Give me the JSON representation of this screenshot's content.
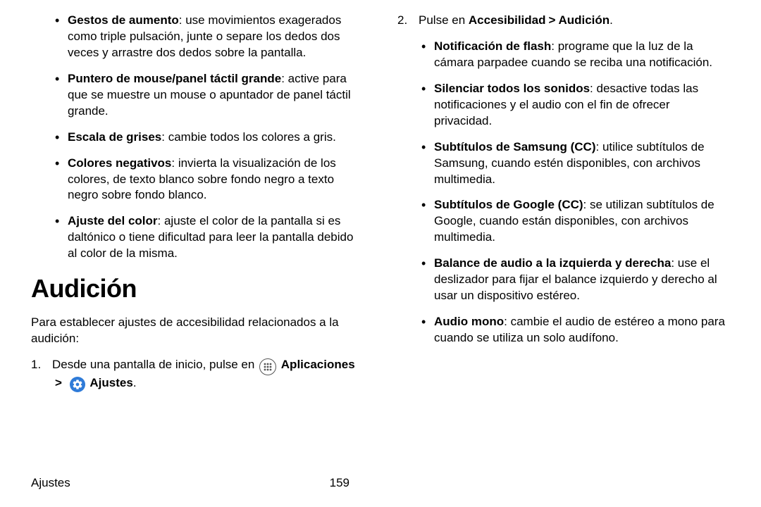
{
  "footer": {
    "section": "Ajustes",
    "page": "159"
  },
  "left": {
    "bullets": [
      {
        "term": "Gestos de aumento",
        "def": ": use movimientos exagerados como triple pulsación, junte o separe los dedos dos veces y arrastre dos dedos sobre la pantalla."
      },
      {
        "term": "Puntero de mouse/panel táctil grande",
        "def": ": active para que se muestre un mouse o apuntador de panel táctil grande."
      },
      {
        "term": "Escala de grises",
        "def": ": cambie todos los colores a gris."
      },
      {
        "term": "Colores negativos",
        "def": ": invierta la visualización de los colores, de texto blanco sobre fondo negro a texto negro sobre fondo blanco."
      },
      {
        "term": "Ajuste del color",
        "def": ": ajuste el color de la pantalla si es daltónico o tiene dificultad para leer la pantalla debido al color de la misma."
      }
    ],
    "heading": "Audición",
    "intro": "Para establecer ajustes de accesibilidad relacionados a la audición:",
    "step1": {
      "num": "1.",
      "pre": "Desde una pantalla de inicio, pulse en ",
      "apps": "Aplicaciones",
      "arrow": ">",
      "settings": "Ajustes",
      "post": "."
    }
  },
  "right": {
    "step2": {
      "num": "2.",
      "pre": "Pulse en ",
      "a": "Accesibilidad",
      "arrow": ">",
      "b": "Audición",
      "post": "."
    },
    "bullets": [
      {
        "term": "Notificación de flash",
        "def": ": programe que la luz de la cámara parpadee cuando se reciba una notificación."
      },
      {
        "term": "Silenciar todos los sonidos",
        "def": ": desactive todas las notificaciones y el audio con el fin de ofrecer privacidad."
      },
      {
        "term": "Subtítulos de Samsung (CC)",
        "def": ": utilice subtítulos de Samsung, cuando estén disponibles, con archivos multimedia."
      },
      {
        "term": "Subtítulos de Google (CC)",
        "def": ": se utilizan subtítulos de Google, cuando están disponibles, con archivos multimedia."
      },
      {
        "term": "Balance de audio a la izquierda y derecha",
        "def": ": use el deslizador para fijar el balance izquierdo y derecho al usar un dispositivo estéreo."
      },
      {
        "term": "Audio mono",
        "def": ": cambie el audio de estéreo a mono para cuando se utiliza un solo audífono."
      }
    ]
  }
}
